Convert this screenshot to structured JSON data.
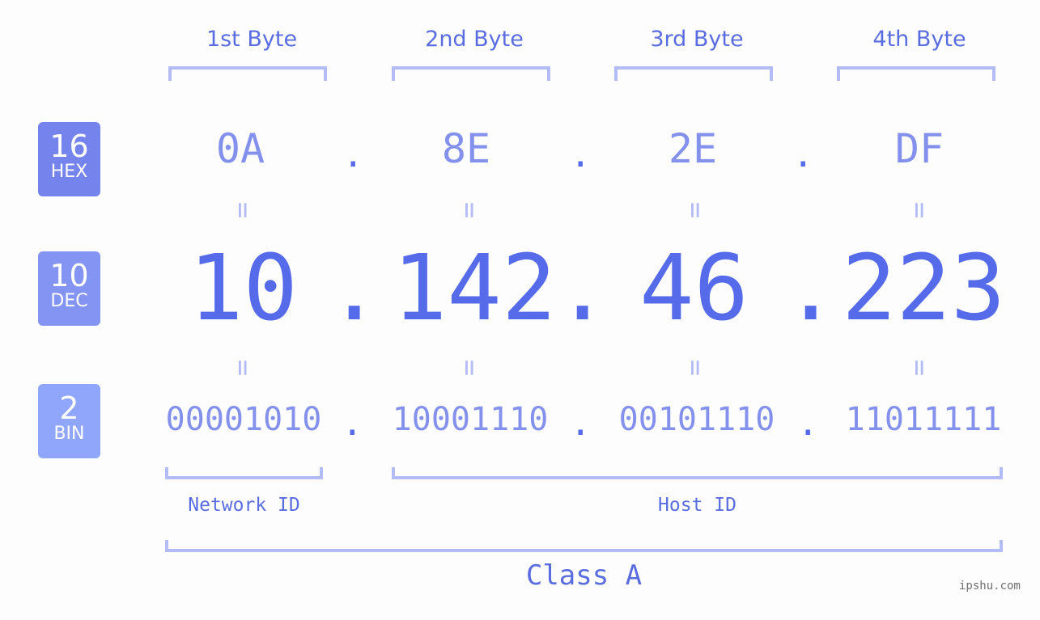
{
  "bytes": [
    {
      "label": "1st Byte",
      "hex": "0A",
      "dec": "10",
      "bin": "00001010"
    },
    {
      "label": "2nd Byte",
      "hex": "8E",
      "dec": "142",
      "bin": "10001110"
    },
    {
      "label": "3rd Byte",
      "hex": "2E",
      "dec": "46",
      "bin": "00101110"
    },
    {
      "label": "4th Byte",
      "hex": "DF",
      "dec": "223",
      "bin": "11011111"
    }
  ],
  "separator": ".",
  "equals": "=",
  "badges": {
    "hex": {
      "base": "16",
      "name": "HEX",
      "color": "#7584ec"
    },
    "dec": {
      "base": "10",
      "name": "DEC",
      "color": "#8494f2"
    },
    "bin": {
      "base": "2",
      "name": "BIN",
      "color": "#8fa6fb"
    }
  },
  "network_id_label": "Network ID",
  "host_id_label": "Host ID",
  "class_label": "Class A",
  "watermark": "ipshu.com",
  "colors": {
    "accent": "#566bea",
    "light": "#8391ec",
    "bracket": "#b3bcf5"
  }
}
